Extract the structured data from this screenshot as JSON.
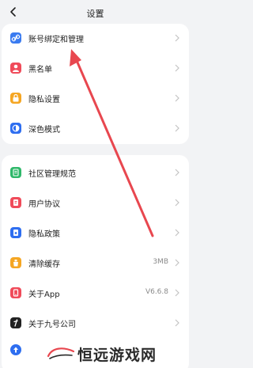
{
  "header": {
    "title": "设置"
  },
  "group1": [
    {
      "label": "账号绑定和管理",
      "icon": "link-icon",
      "color": "#3a7bf0"
    },
    {
      "label": "黑名单",
      "icon": "blacklist-icon",
      "color": "#f04b5a"
    },
    {
      "label": "隐私设置",
      "icon": "lock-icon",
      "color": "#f5a623"
    },
    {
      "label": "深色模式",
      "icon": "dark-mode-icon",
      "color": "#2e6ef0"
    }
  ],
  "group2": [
    {
      "label": "社区管理规范",
      "icon": "community-rules-icon",
      "color": "#2fb86a"
    },
    {
      "label": "用户协议",
      "icon": "user-agreement-icon",
      "color": "#f04b5a"
    },
    {
      "label": "隐私政策",
      "icon": "privacy-policy-icon",
      "color": "#2e6ef0"
    },
    {
      "label": "清除缓存",
      "icon": "clear-cache-icon",
      "color": "#f5a623",
      "value": "3MB"
    },
    {
      "label": "关于App",
      "icon": "about-app-icon",
      "color": "#f04b5a",
      "value": "V6.6.8"
    },
    {
      "label": "关于九号公司",
      "icon": "about-company-icon",
      "color": "#222222"
    },
    {
      "label": "",
      "icon": "update-icon",
      "color": "#2e6ef0"
    }
  ],
  "watermark": {
    "text": "恒远游戏网"
  },
  "colors": {
    "accent_arrow": "#e8474f",
    "background": "#f2f3f5"
  }
}
